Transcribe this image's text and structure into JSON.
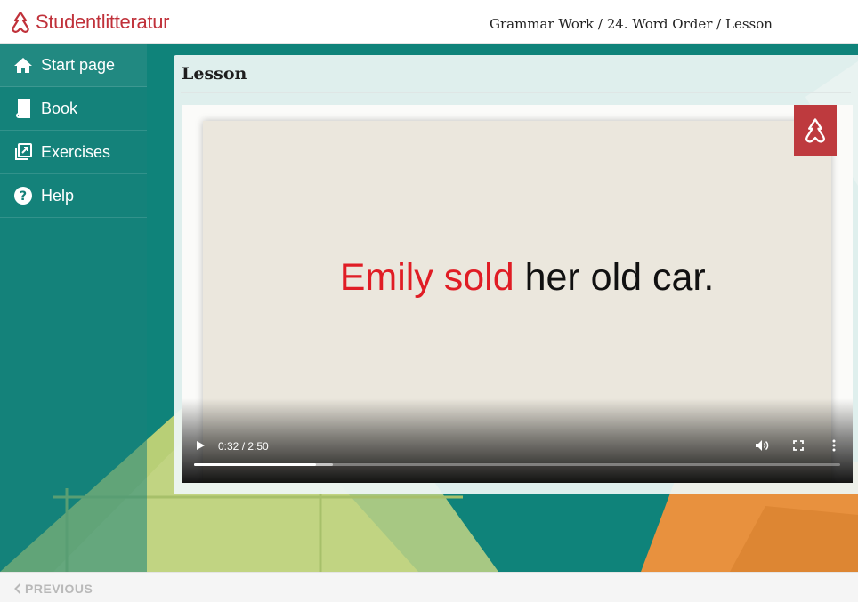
{
  "header": {
    "brand": "Studentlitteratur",
    "brand_color": "#c0313a",
    "breadcrumb": "Grammar Work / 24. Word Order / Lesson"
  },
  "sidebar": {
    "items": [
      {
        "label": "Start page",
        "icon": "home-icon"
      },
      {
        "label": "Book",
        "icon": "book-icon"
      },
      {
        "label": "Exercises",
        "icon": "exercises-icon"
      },
      {
        "label": "Help",
        "icon": "help-icon"
      }
    ]
  },
  "main": {
    "title": "Lesson",
    "video": {
      "sentence_highlight": "Emily sold",
      "sentence_rest": " her old car.",
      "highlight_color": "#e01d25",
      "time": "0:32 / 2:50",
      "progress": 0.1882,
      "buffered": 0.215
    }
  },
  "footer": {
    "previous_label": "PREVIOUS"
  }
}
